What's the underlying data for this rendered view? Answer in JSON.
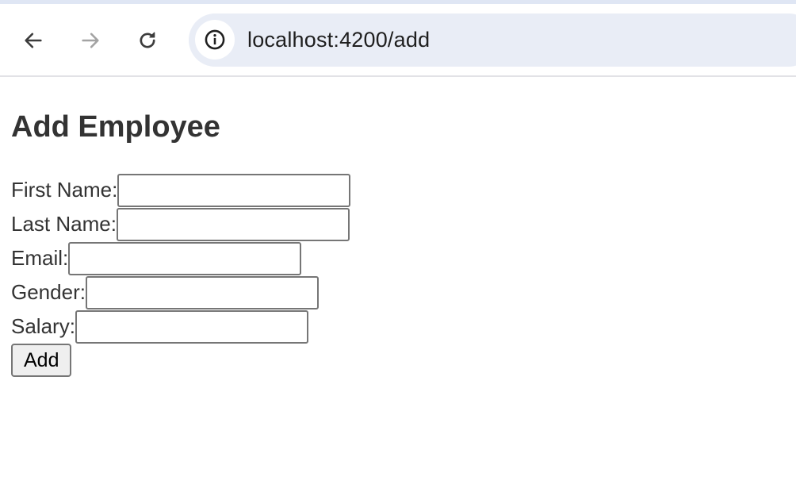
{
  "browser": {
    "url": "localhost:4200/add",
    "back_icon": "arrow-left-icon",
    "forward_icon": "arrow-right-icon",
    "reload_icon": "reload-icon",
    "site_info_icon": "info-icon"
  },
  "page": {
    "title": "Add Employee",
    "form": {
      "fields": [
        {
          "label": "First Name:",
          "value": "",
          "placeholder": ""
        },
        {
          "label": "Last Name:",
          "value": "",
          "placeholder": ""
        },
        {
          "label": "Email:",
          "value": "",
          "placeholder": ""
        },
        {
          "label": "Gender:",
          "value": "",
          "placeholder": ""
        },
        {
          "label": "Salary:",
          "value": "",
          "placeholder": ""
        }
      ],
      "submit_label": "Add"
    }
  },
  "colors": {
    "text": "#333333",
    "chrome_accent": "#dfe6f4",
    "omnibox_bg": "#e9edf6",
    "input_border": "#767676",
    "button_bg": "#efefef"
  }
}
